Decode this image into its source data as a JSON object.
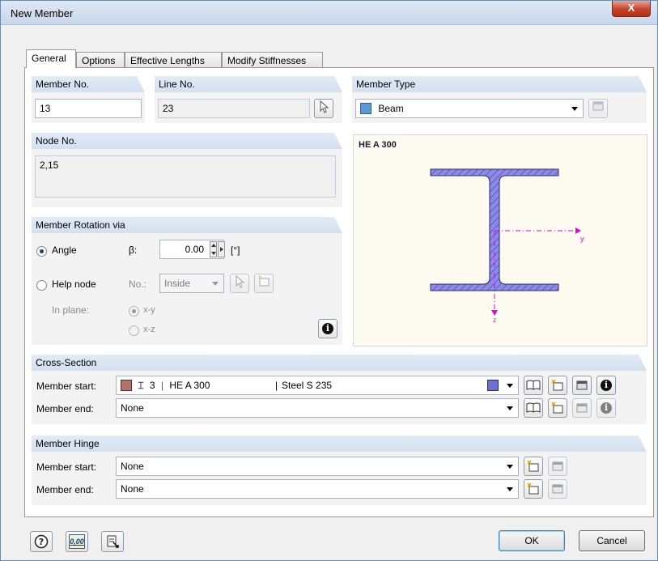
{
  "window": {
    "title": "New Member",
    "close_label": "X"
  },
  "tabs": [
    "General",
    "Options",
    "Effective Lengths",
    "Modify Stiffnesses"
  ],
  "member_no": {
    "label": "Member No.",
    "value": "13"
  },
  "line_no": {
    "label": "Line No.",
    "value": "23"
  },
  "member_type": {
    "label": "Member Type",
    "value": "Beam",
    "color": "#5b9bd5"
  },
  "node_no": {
    "label": "Node No.",
    "value": "2,15"
  },
  "preview": {
    "section_name": "HE A 300",
    "axis_y": "y",
    "axis_z": "z"
  },
  "rotation": {
    "label": "Member Rotation via",
    "angle_label": "Angle",
    "beta_label": "β:",
    "beta_value": "0.00",
    "unit": "[°]",
    "help_node_label": "Help node",
    "no_label": "No.:",
    "no_value": "Inside",
    "in_plane_label": "In plane:",
    "plane_xy": "x-y",
    "plane_xz": "x-z"
  },
  "cross_section": {
    "label": "Cross-Section",
    "start_label": "Member start:",
    "start_number": "3",
    "start_name": "HE A 300",
    "start_material": "Steel S 235",
    "start_color": "#b5706a",
    "material_color": "#6b6fd8",
    "end_label": "Member end:",
    "end_value": "None"
  },
  "hinge": {
    "label": "Member Hinge",
    "start_label": "Member start:",
    "start_value": "None",
    "end_label": "Member end:",
    "end_value": "None"
  },
  "footer": {
    "ok_label": "OK",
    "cancel_label": "Cancel",
    "units_label": "0,00"
  }
}
